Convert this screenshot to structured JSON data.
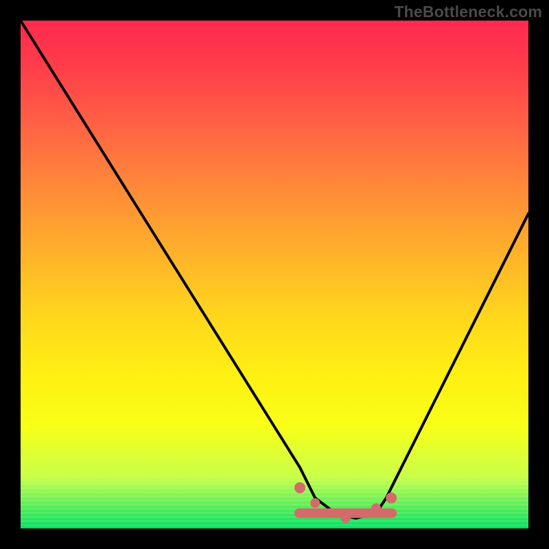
{
  "watermark": "TheBottleneck.com",
  "chart_data": {
    "type": "line",
    "title": "",
    "xlabel": "",
    "ylabel": "",
    "xlim": [
      0,
      100
    ],
    "ylim": [
      0,
      100
    ],
    "grid": false,
    "legend": false,
    "background_gradient": {
      "top": "#ff2a4f",
      "bottom": "#00e060",
      "stops": [
        "red",
        "orange",
        "yellow",
        "green"
      ]
    },
    "series": [
      {
        "name": "bottleneck-curve",
        "description": "V-shaped curve; high on left, descends to flat trough around x≈58-72, rises steeply on right.",
        "x": [
          0,
          5,
          10,
          15,
          20,
          25,
          30,
          35,
          40,
          45,
          50,
          55,
          58,
          62,
          66,
          70,
          72,
          75,
          80,
          85,
          90,
          95,
          100
        ],
        "values": [
          100,
          92,
          84,
          76,
          68,
          60,
          52,
          44,
          36,
          28,
          20,
          12,
          6,
          3,
          2,
          3,
          6,
          12,
          22,
          32,
          42,
          52,
          62
        ]
      }
    ],
    "markers": {
      "name": "optimal-range-markers",
      "color": "#d46a6a",
      "x": [
        55,
        58,
        61,
        64,
        67,
        70,
        73
      ],
      "values": [
        8,
        5,
        3,
        2,
        3,
        4,
        6
      ]
    }
  },
  "colors": {
    "frame": "#000000",
    "marker": "#d46a6a",
    "curve": "#000000",
    "watermark": "#4a4a4a"
  }
}
